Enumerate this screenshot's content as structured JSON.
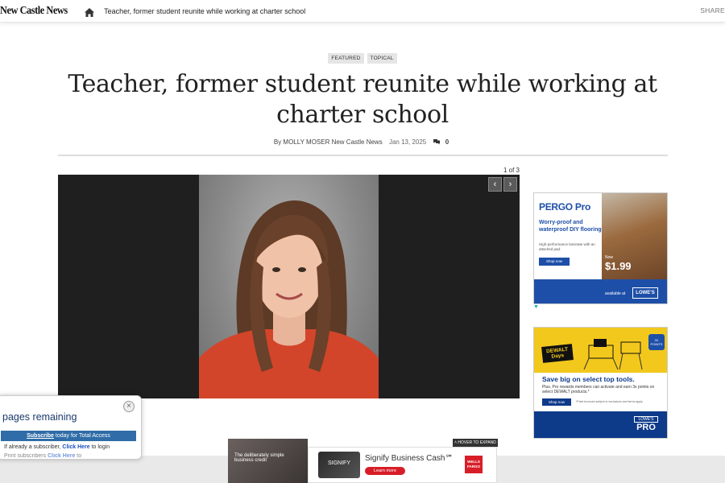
{
  "header": {
    "logo": "New Castle News",
    "title": "Teacher, former student reunite while working at charter school",
    "share_label": "SHARE"
  },
  "article": {
    "tags": [
      "FEATURED",
      "TOPICAL"
    ],
    "headline": "Teacher, former student reunite while working at charter school",
    "byline": "By MOLLY MOSER New Castle News",
    "date": "Jan 13, 2025",
    "comments": "0"
  },
  "gallery": {
    "counter": "1 of 3"
  },
  "ads": {
    "pergo": {
      "brand": "PERGO Pro",
      "headline": "Worry-proof and waterproof DIY flooring",
      "sub": "High-performance laminate with an attached pad.",
      "cta": "Shop now",
      "price_prefix": "Now",
      "price": "$1.99",
      "avail": "available at",
      "store": "LOWE'S"
    },
    "dewalt": {
      "brand": "DEWALT Days",
      "badge": "3X POINTS",
      "headline": "Save big on select top tools.",
      "sub": "Plus, Pro rewards members can activate and earn 3x points on select DEWALT products.*",
      "cta": "Shop now",
      "fine": "*Point bonuses subject to exclusions and terms apply.",
      "store": "LOWE'S",
      "store_sub": "PRO"
    },
    "bottom": {
      "left_text": "The deliberately simple business credit",
      "card": "SIGNIFY",
      "title": "Signify Business Cash℠",
      "cta": "Learn more",
      "bank": "WELLS FARGO",
      "expand": "HOVER TO EXPAND"
    }
  },
  "paywall": {
    "remaining": "pages remaining",
    "subscribe_link": "Subscribe",
    "subscribe_text": "today for Total Access",
    "login_prefix": "If already a subscriber,",
    "login_link": "Click Here",
    "login_suffix": "to login",
    "print_prefix": "Print subscribers",
    "print_link": "Click Here",
    "print_suffix": "to"
  },
  "colors": {
    "pergo_blue": "#1e4fa8",
    "lowes_blue": "#0e3a8a",
    "dewalt_yellow": "#f2c81c",
    "paywall_blue": "#2f6ca8",
    "wf_red": "#d71e28"
  }
}
